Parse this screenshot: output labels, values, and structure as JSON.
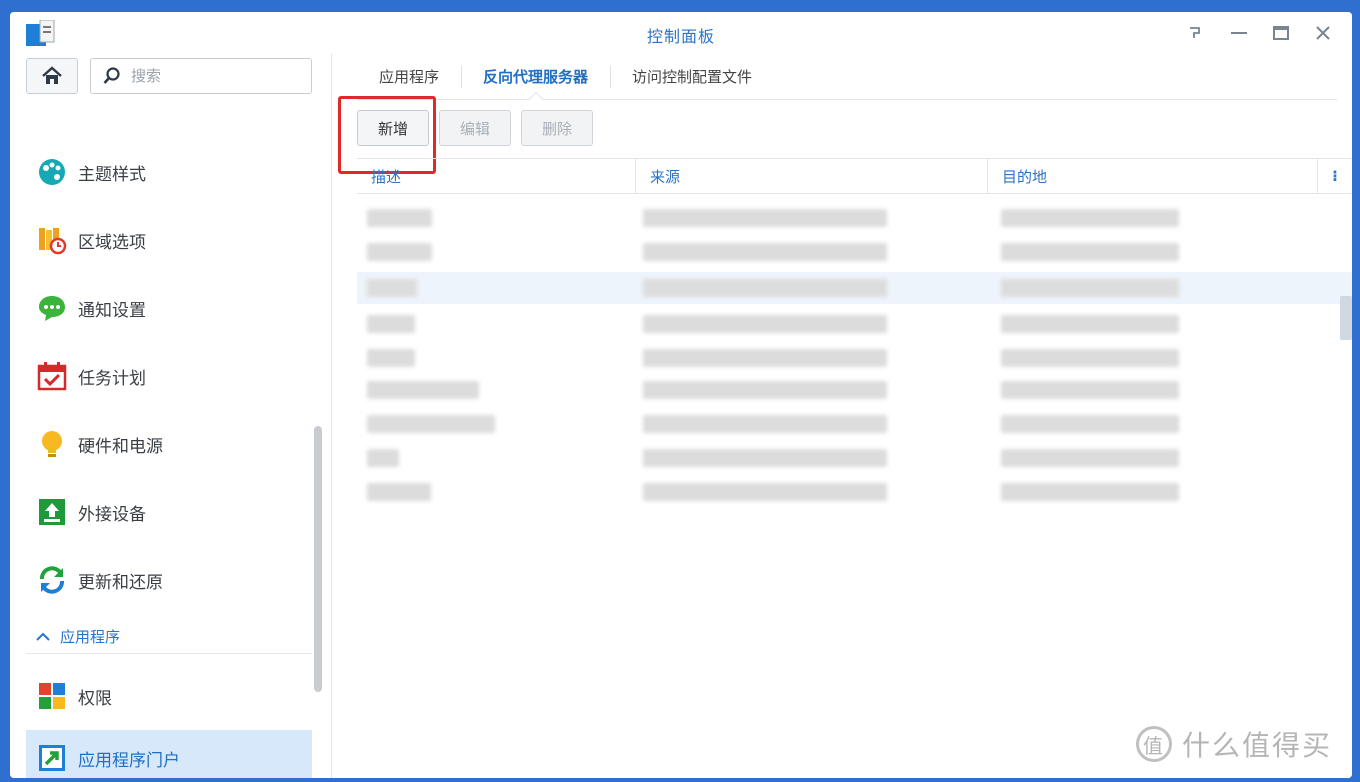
{
  "window": {
    "title": "控制面板"
  },
  "sidebar": {
    "search_placeholder": "搜索",
    "items": [
      {
        "label": "主题样式",
        "icon": "palette-icon"
      },
      {
        "label": "区域选项",
        "icon": "region-clock-icon"
      },
      {
        "label": "通知设置",
        "icon": "chat-bubble-icon"
      },
      {
        "label": "任务计划",
        "icon": "calendar-check-icon"
      },
      {
        "label": "硬件和电源",
        "icon": "lightbulb-icon"
      },
      {
        "label": "外接设备",
        "icon": "upload-icon"
      },
      {
        "label": "更新和还原",
        "icon": "refresh-icon"
      }
    ],
    "section": {
      "label": "应用程序"
    },
    "section_items": [
      {
        "label": "权限",
        "icon": "permission-grid-icon"
      },
      {
        "label": "应用程序门户",
        "icon": "app-portal-icon",
        "active": true
      }
    ]
  },
  "tabs": [
    {
      "label": "应用程序"
    },
    {
      "label": "反向代理服务器",
      "active": true
    },
    {
      "label": "访问控制配置文件"
    }
  ],
  "toolbar": {
    "create_label": "新增",
    "edit_label": "编辑",
    "delete_label": "删除"
  },
  "table": {
    "columns": [
      "描述",
      "来源",
      "目的地"
    ],
    "more_glyph": "⁝"
  },
  "watermark": {
    "text": "什么值得买",
    "logo_glyph": "值"
  },
  "colors": {
    "accent": "#2a73c8",
    "active_bg": "#d7e8fa",
    "highlight": "#e02a2a"
  }
}
